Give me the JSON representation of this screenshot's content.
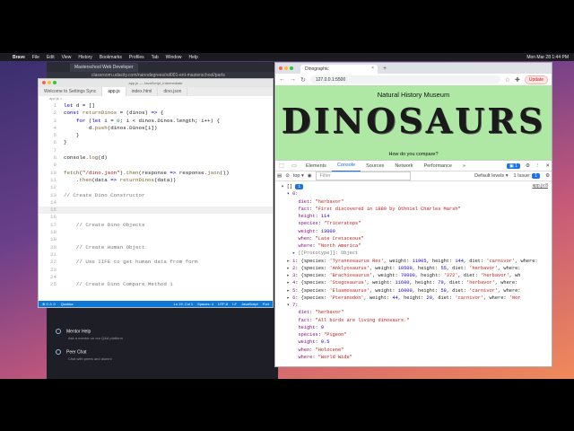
{
  "menubar": {
    "app": "Brave",
    "items": [
      "File",
      "Edit",
      "View",
      "History",
      "Bookmarks",
      "Profiles",
      "Tab",
      "Window",
      "Help"
    ],
    "clock": "Mon Mar 28  1:44 PM"
  },
  "bg_browser": {
    "tab": "Masterschool Web Developer",
    "address": "classroom.udacity.com/nanodegrees/nd001-ent-masterschool/parts",
    "items": [
      {
        "title": "Mentor Help",
        "sub": "Ask a mentor on our Q&A platform"
      },
      {
        "title": "Peer Chat",
        "sub": "Chat with peers and alumni"
      }
    ]
  },
  "vscode": {
    "title": "app.js — JavaScript_Intermediate",
    "tabs": [
      "Welcome to Settings Sync",
      "app.js",
      "index.html",
      "dino.json"
    ],
    "crumb": "app.js > ...",
    "status": {
      "left": [
        "⊗ 0 ⚠ 0",
        "Quokka"
      ],
      "right": [
        "Ln 19, Col 1",
        "Spaces: 4",
        "UTF-8",
        "LF",
        "JavaScript",
        "Port"
      ]
    }
  },
  "chrome": {
    "tab": "Dinographic",
    "url": "127.0.0.1:5500",
    "update": "Update",
    "page": {
      "museum": "Natural History Museum",
      "title": "DINOSAURS",
      "compare": "How do you compare?"
    }
  },
  "devtools": {
    "tabs": [
      "Elements",
      "Console",
      "Sources",
      "Network",
      "Performance"
    ],
    "active": "Console",
    "issues_count": "1",
    "context": "top",
    "filter_placeholder": "Filter",
    "levels": "Default levels",
    "issue_label": "1 Issue:",
    "issue_num": "1",
    "source_link": "app.js:8"
  },
  "colors": {
    "page_bg": "#aee8a4",
    "status_bar": "#0e78d4",
    "accent": "#1a73e8"
  }
}
